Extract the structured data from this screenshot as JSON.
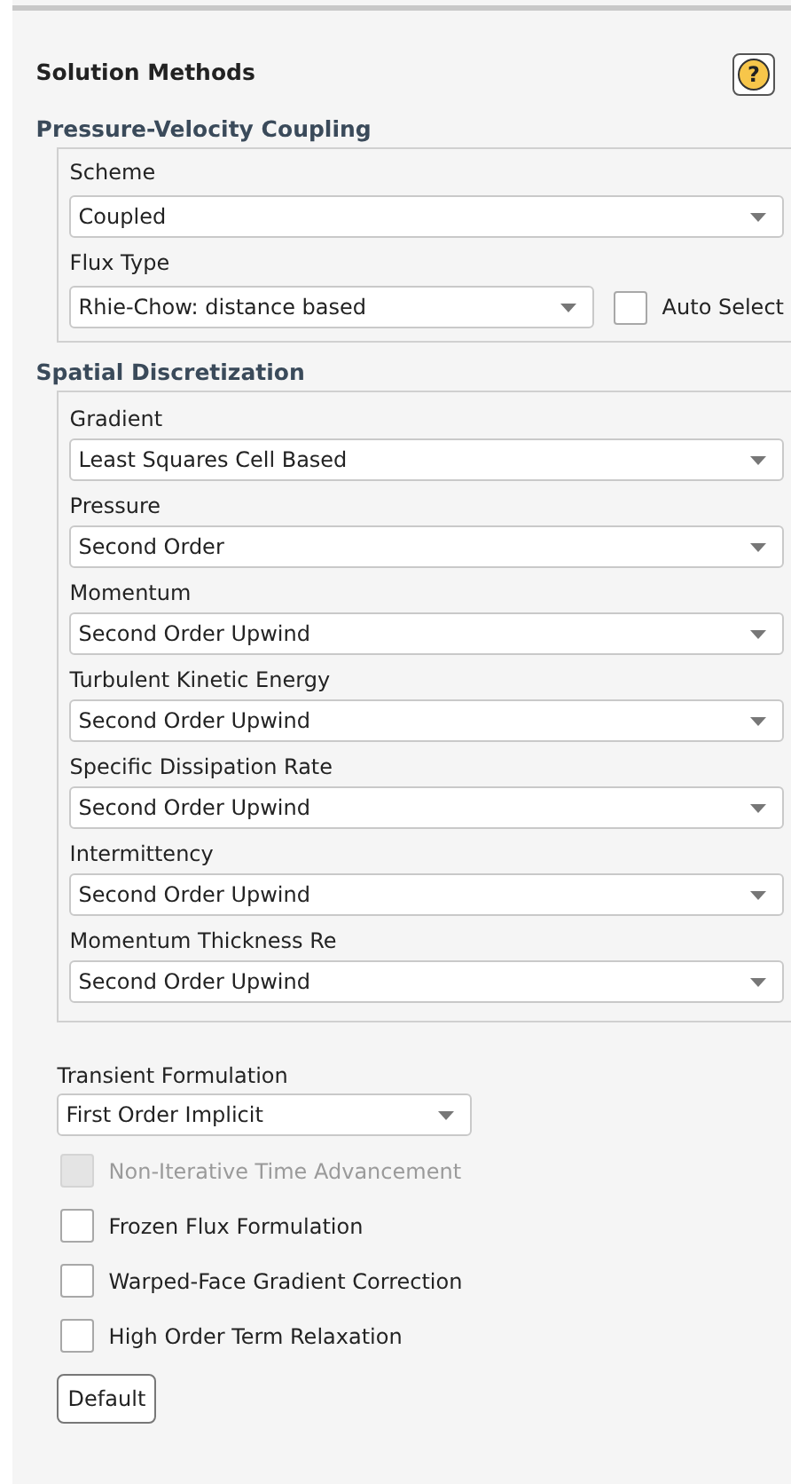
{
  "title": "Solution Methods",
  "help_button": {
    "label": "?"
  },
  "pressure_velocity_coupling": {
    "heading": "Pressure-Velocity Coupling",
    "scheme": {
      "label": "Scheme",
      "value": "Coupled"
    },
    "flux_type": {
      "label": "Flux Type",
      "value": "Rhie-Chow: distance based"
    },
    "auto_select": {
      "label": "Auto Select",
      "checked": false
    }
  },
  "spatial_discretization": {
    "heading": "Spatial Discretization",
    "fields": [
      {
        "label": "Gradient",
        "value": "Least Squares Cell Based"
      },
      {
        "label": "Pressure",
        "value": "Second Order"
      },
      {
        "label": "Momentum",
        "value": "Second Order Upwind"
      },
      {
        "label": "Turbulent Kinetic Energy",
        "value": "Second Order Upwind"
      },
      {
        "label": "Specific Dissipation Rate",
        "value": "Second Order Upwind"
      },
      {
        "label": "Intermittency",
        "value": "Second Order Upwind"
      },
      {
        "label": "Momentum Thickness Re",
        "value": "Second Order Upwind"
      }
    ]
  },
  "transient_formulation": {
    "label": "Transient Formulation",
    "value": "First Order Implicit"
  },
  "options": [
    {
      "label": "Non-Iterative Time Advancement",
      "checked": false,
      "disabled": true
    },
    {
      "label": "Frozen Flux Formulation",
      "checked": false,
      "disabled": false
    },
    {
      "label": "Warped-Face Gradient Correction",
      "checked": false,
      "disabled": false
    },
    {
      "label": "High Order Term Relaxation",
      "checked": false,
      "disabled": false
    }
  ],
  "default_button": {
    "label": "Default"
  }
}
